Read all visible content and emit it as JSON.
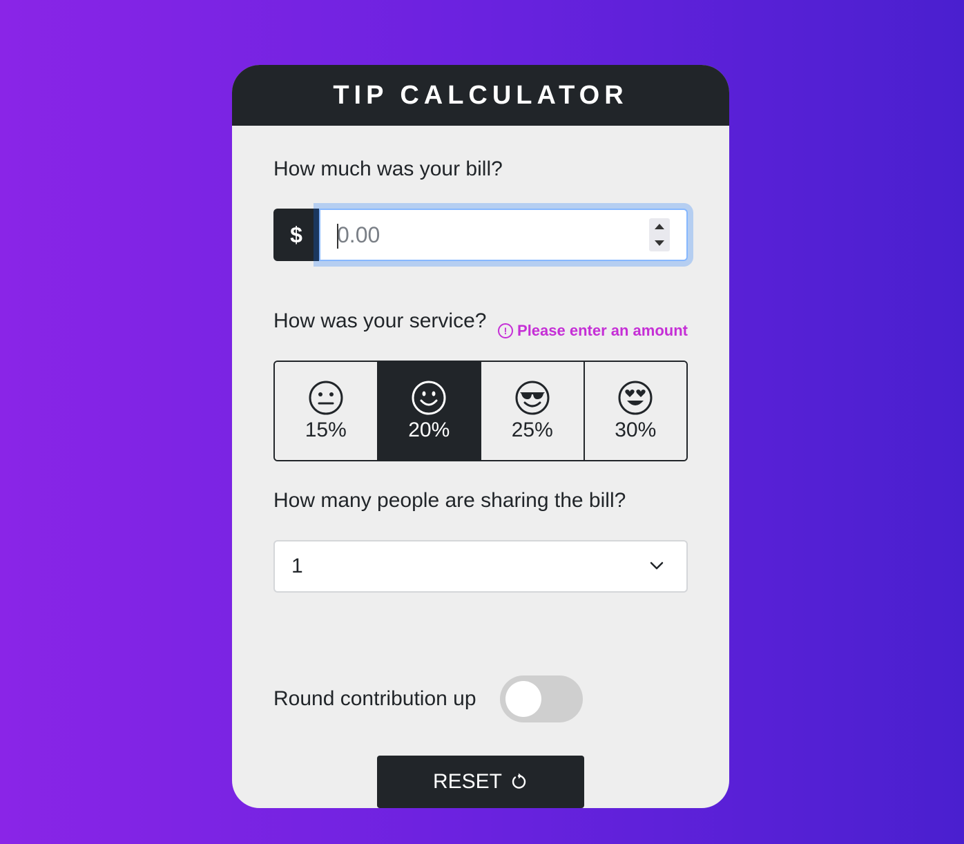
{
  "app": {
    "title": "TIP CALCULATOR"
  },
  "bill": {
    "question": "How much was your bill?",
    "currency_symbol": "$",
    "placeholder": "0.00",
    "value": "",
    "validation_message": "Please enter an amount"
  },
  "service": {
    "question": "How was your service?",
    "options": [
      {
        "label": "15%",
        "icon": "neutral-face-icon",
        "selected": false
      },
      {
        "label": "20%",
        "icon": "smiling-face-icon",
        "selected": true
      },
      {
        "label": "25%",
        "icon": "sunglasses-face-icon",
        "selected": false
      },
      {
        "label": "30%",
        "icon": "heart-eyes-face-icon",
        "selected": false
      }
    ]
  },
  "people": {
    "question": "How many people are sharing the bill?",
    "selected": "1"
  },
  "round": {
    "label": "Round contribution up",
    "enabled": false
  },
  "reset": {
    "label": "RESET"
  },
  "colors": {
    "bg_left": "#8a25e7",
    "bg_right": "#4a1fcf",
    "dark": "#212529",
    "card": "#eeeeee",
    "error": "#c52fd6"
  }
}
